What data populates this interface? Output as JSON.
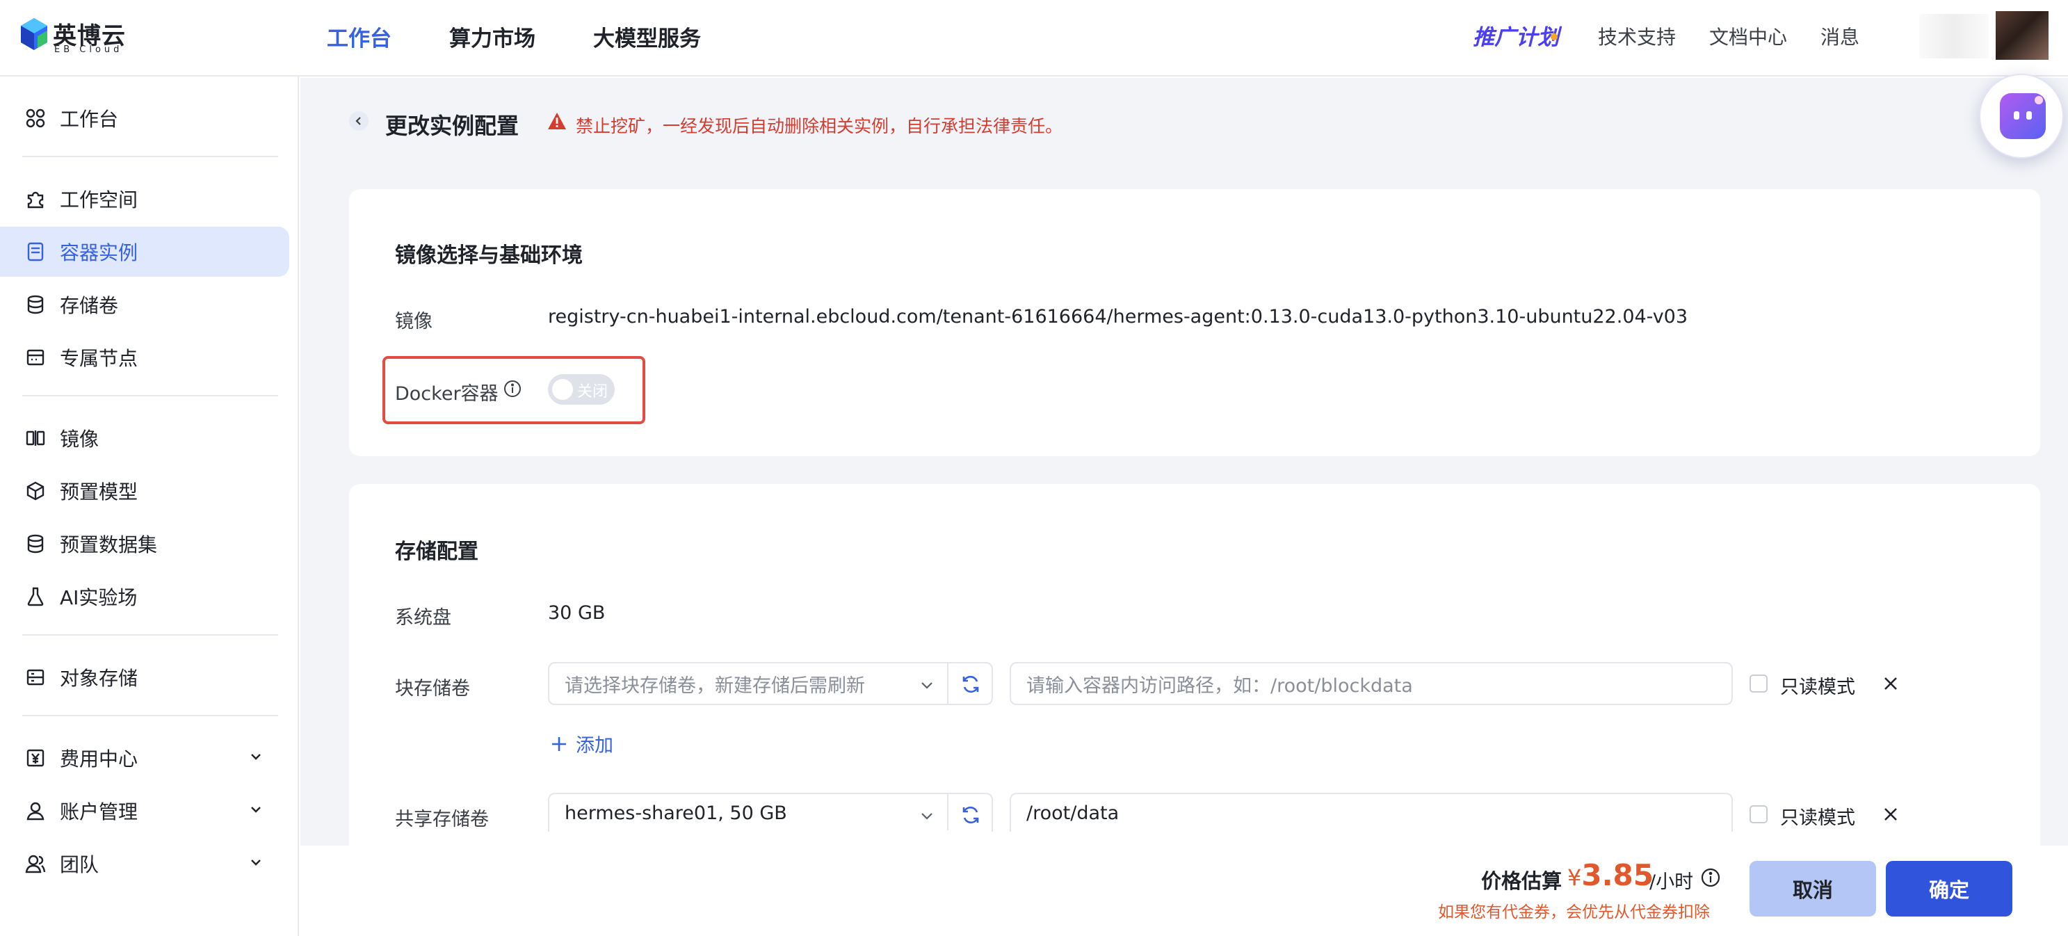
{
  "brand": {
    "name": "英博云",
    "sub": "EB Cloud"
  },
  "top_nav": [
    {
      "label": "工作台",
      "active": true
    },
    {
      "label": "算力市场",
      "active": false
    },
    {
      "label": "大模型服务",
      "active": false
    }
  ],
  "top_right": {
    "promo": "推广计划",
    "links": [
      "技术支持",
      "文档中心",
      "消息"
    ]
  },
  "sidebar": {
    "items": [
      {
        "label": "工作台",
        "icon": "grid-icon"
      },
      {
        "label": "工作空间",
        "icon": "puzzle-icon"
      },
      {
        "label": "容器实例",
        "icon": "container-icon",
        "active": true
      },
      {
        "label": "存储卷",
        "icon": "database-icon"
      },
      {
        "label": "专属节点",
        "icon": "node-icon"
      },
      {
        "label": "镜像",
        "icon": "mirror-icon"
      },
      {
        "label": "预置模型",
        "icon": "cube-icon"
      },
      {
        "label": "预置数据集",
        "icon": "database-icon"
      },
      {
        "label": "AI实验场",
        "icon": "flask-icon"
      },
      {
        "label": "对象存储",
        "icon": "storage-icon"
      },
      {
        "label": "费用中心",
        "icon": "yen-icon",
        "expandable": true
      },
      {
        "label": "账户管理",
        "icon": "user-icon",
        "expandable": true
      },
      {
        "label": "团队",
        "icon": "team-icon",
        "expandable": true
      }
    ]
  },
  "page": {
    "title": "更改实例配置",
    "warning": "禁止挖矿，一经发现后自动删除相关实例，自行承担法律责任。"
  },
  "image_section": {
    "title": "镜像选择与基础环境",
    "image_label": "镜像",
    "image_value": "registry-cn-huabei1-internal.ebcloud.com/tenant-61616664/hermes-agent:0.13.0-cuda13.0-python3.10-ubuntu22.04-v03",
    "docker_label": "Docker容器",
    "docker_toggle_text": "关闭",
    "docker_enabled": false
  },
  "storage_section": {
    "title": "存储配置",
    "system_disk_label": "系统盘",
    "system_disk_value": "30 GB",
    "block_label": "块存储卷",
    "block_select_placeholder": "请选择块存储卷，新建存储后需刷新",
    "block_path_placeholder": "请输入容器内访问路径，如：/root/blockdata",
    "readonly_label": "只读模式",
    "add_label": "添加",
    "shared_label": "共享存储卷",
    "shared_select_value": "hermes-share01, 50 GB",
    "shared_path_value": "/root/data"
  },
  "footer": {
    "price_label": "价格估算",
    "currency": "¥",
    "price": "3.85",
    "unit": "/小时",
    "note": "如果您有代金券，会优先从代金券扣除",
    "cancel": "取消",
    "confirm": "确定"
  },
  "colors": {
    "accent": "#3661e0",
    "warning": "#d63b2f",
    "price": "#e0582c",
    "highlight": "#e44b42"
  }
}
